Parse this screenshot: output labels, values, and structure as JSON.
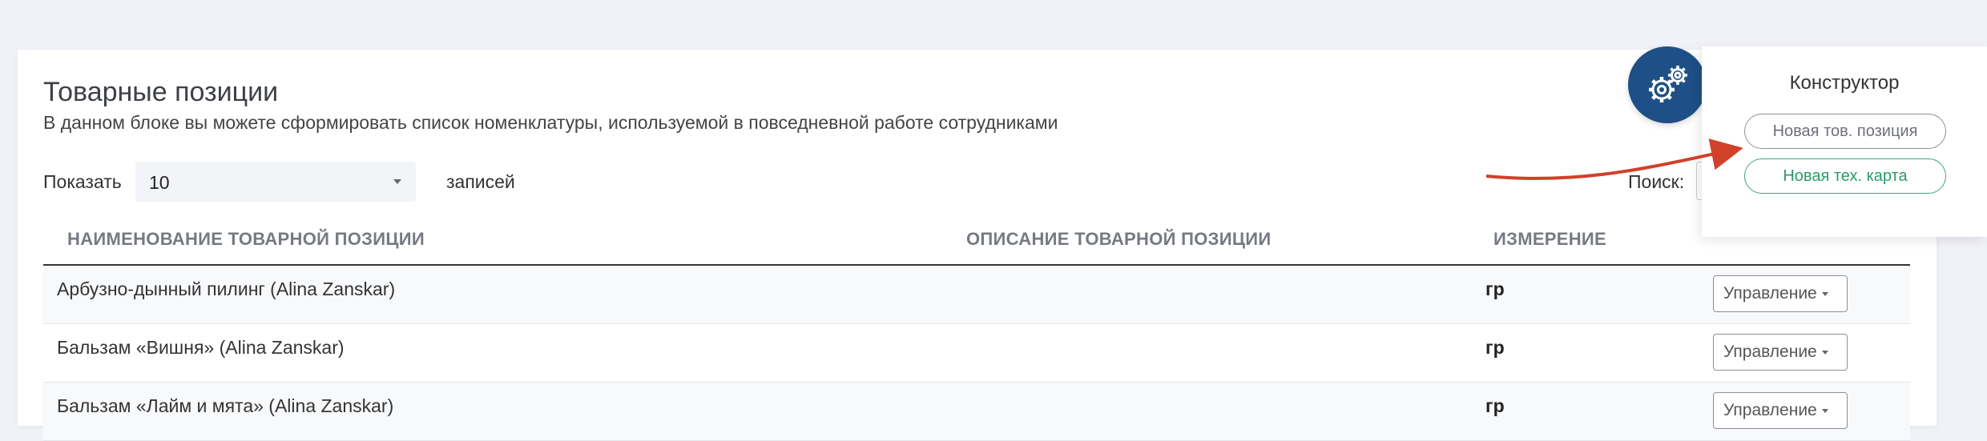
{
  "header": {
    "title": "Товарные позиции",
    "subtitle": "В данном блоке вы можете сформировать список номенклатуры, используемой в повседневной работе сотрудниками"
  },
  "controls": {
    "show_label": "Показать",
    "page_size": "10",
    "show_suffix": "записей",
    "search_label": "Поиск:",
    "search_value": ""
  },
  "table": {
    "columns": [
      "Наименование товарной позиции",
      "Описание товарной позиции",
      "Измерение"
    ],
    "rows": [
      {
        "name": "Арбузно-дынный пилинг (Alina Zanskar)",
        "description": "",
        "unit": "гр",
        "action": "Управление"
      },
      {
        "name": "Бальзам «Вишня» (Alina Zanskar)",
        "description": "",
        "unit": "гр",
        "action": "Управление"
      },
      {
        "name": "Бальзам «Лайм и мята» (Alina Zanskar)",
        "description": "",
        "unit": "гр",
        "action": "Управление"
      }
    ]
  },
  "constructor": {
    "title": "Конструктор",
    "new_item_label": "Новая тов. позиция",
    "new_techcard_label": "Новая тех. карта",
    "toggle_icon": "gears-icon"
  },
  "colors": {
    "accent_blue": "#1e4f86",
    "accent_green": "#3aa978",
    "annotation_red": "#d0402a",
    "background": "#f1f2f8"
  }
}
